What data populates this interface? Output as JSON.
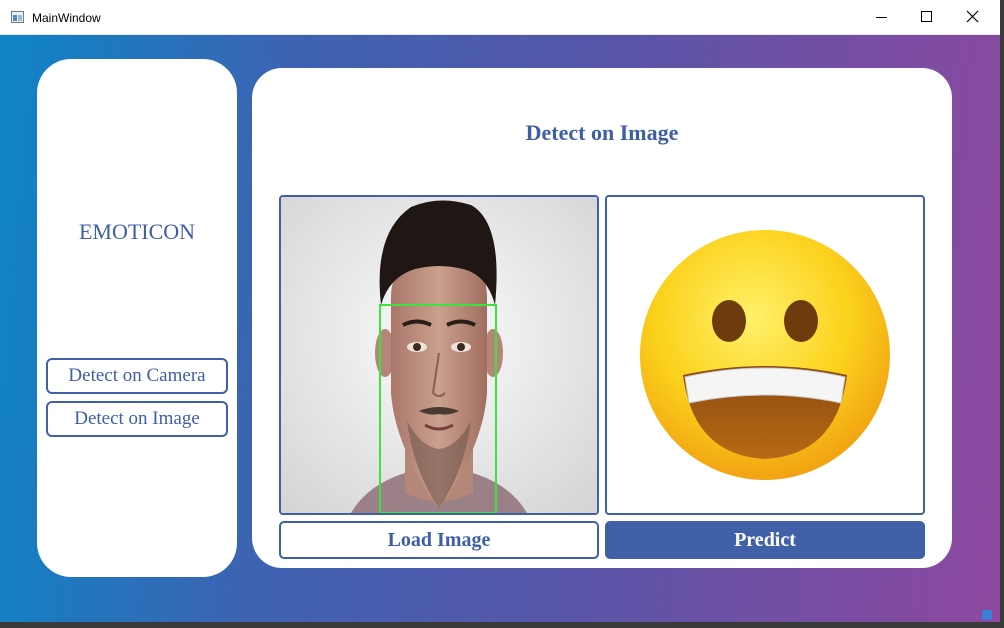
{
  "window": {
    "title": "MainWindow"
  },
  "sidebar": {
    "brand": "EMOTICON",
    "buttons": [
      {
        "label": "Detect on Camera"
      },
      {
        "label": "Detect on Image"
      }
    ]
  },
  "main": {
    "title": "Detect on Image",
    "input_panel": {
      "content": "face-photo",
      "detection_box_color": "#3fe03f"
    },
    "output_panel": {
      "content": "grinning-face-emoji-icon"
    },
    "load_button_label": "Load Image",
    "predict_button_label": "Predict"
  },
  "colors": {
    "accent": "#4060a8",
    "gradient_start": "#0d85c6",
    "gradient_end": "#8e48a0"
  }
}
